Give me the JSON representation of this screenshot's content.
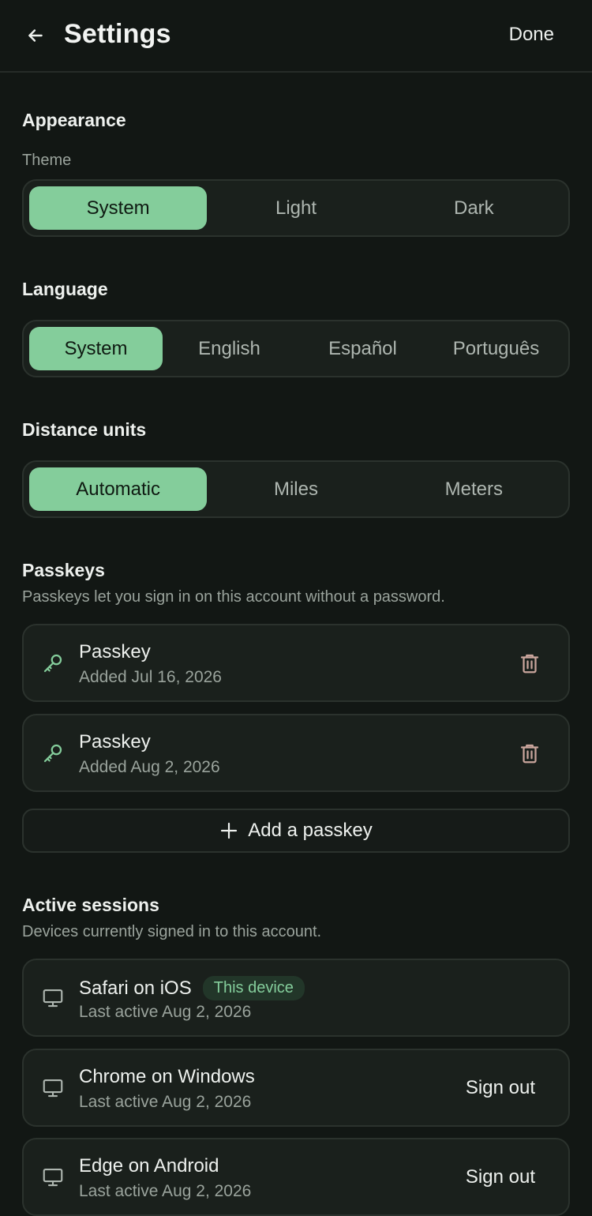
{
  "header": {
    "title": "Settings",
    "done_label": "Done"
  },
  "appearance": {
    "title": "Appearance",
    "theme_label": "Theme",
    "theme_options": [
      "System",
      "Light",
      "Dark"
    ],
    "theme_selected": "System"
  },
  "language": {
    "title": "Language",
    "options": [
      "System",
      "English",
      "Español",
      "Português"
    ],
    "selected": "System"
  },
  "distance": {
    "title": "Distance units",
    "options": [
      "Automatic",
      "Miles",
      "Meters"
    ],
    "selected": "Automatic"
  },
  "passkeys": {
    "title": "Passkeys",
    "description": "Passkeys let you sign in on this account without a password.",
    "items": [
      {
        "name": "Passkey",
        "added": "Added Jul 16, 2026"
      },
      {
        "name": "Passkey",
        "added": "Added Aug 2, 2026"
      }
    ],
    "add_label": "Add a passkey"
  },
  "sessions": {
    "title": "Active sessions",
    "description": "Devices currently signed in to this account.",
    "items": [
      {
        "device": "Safari on iOS",
        "last_active": "Last active Aug 2, 2026",
        "badge": "This device"
      },
      {
        "device": "Chrome on Windows",
        "last_active": "Last active Aug 2, 2026",
        "action": "Sign out"
      },
      {
        "device": "Edge on Android",
        "last_active": "Last active Aug 2, 2026",
        "action": "Sign out"
      }
    ]
  },
  "colors": {
    "background": "#121714",
    "accent": "#84cd9b",
    "card": "#1a201c",
    "muted_text": "#9aa39c"
  }
}
